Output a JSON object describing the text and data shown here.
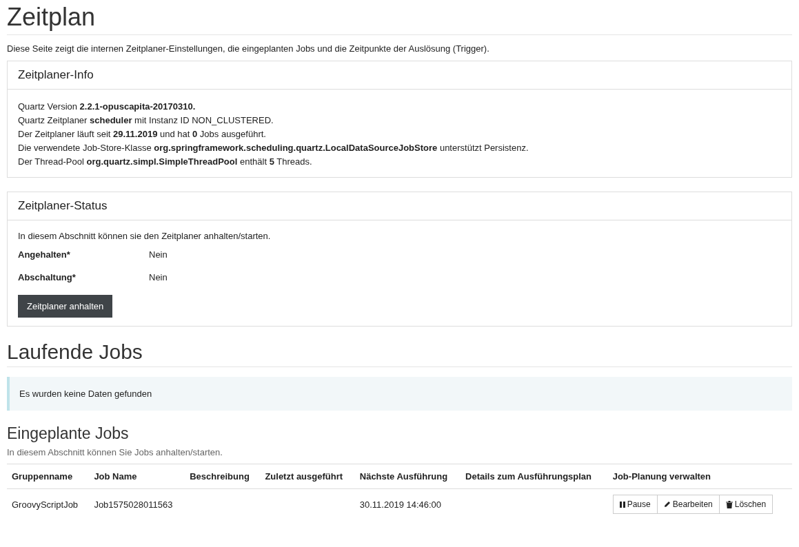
{
  "title": "Zeitplan",
  "intro": "Diese Seite zeigt die internen Zeitplaner-Einstellungen, die eingeplanten Jobs und die Zeitpunkte der Auslösung (Trigger).",
  "info_panel": {
    "heading": "Zeitplaner-Info",
    "lines": [
      "Quartz Version **2.2.1-opuscapita-20170310.**",
      "Quartz Zeitplaner **scheduler** mit Instanz ID NON_CLUSTERED.",
      "Der Zeitplaner läuft seit **29.11.2019** und hat **0** Jobs ausgeführt.",
      "Die verwendete Job-Store-Klasse **org.springframework.scheduling.quartz.LocalDataSourceJobStore** unterstützt Persistenz.",
      "Der Thread-Pool **org.quartz.simpl.SimpleThreadPool** enthält **5** Threads."
    ]
  },
  "status_panel": {
    "heading": "Zeitplaner-Status",
    "description": "In diesem Abschnitt können sie den Zeitplaner anhalten/starten.",
    "fields": [
      {
        "label": "Angehalten*",
        "value": "Nein"
      },
      {
        "label": "Abschaltung*",
        "value": "Nein"
      }
    ],
    "button": "Zeitplaner anhalten"
  },
  "running_jobs": {
    "heading": "Laufende Jobs",
    "empty_message": "Es wurden keine Daten gefunden"
  },
  "scheduled_jobs": {
    "heading": "Eingeplante Jobs",
    "description": "In diesem Abschnitt können Sie Jobs anhalten/starten.",
    "columns": [
      "Gruppenname",
      "Job Name",
      "Beschreibung",
      "Zuletzt ausgeführt",
      "Nächste Ausführung",
      "Details zum Ausführungsplan",
      "Job-Planung verwalten"
    ],
    "rows": [
      {
        "cells": [
          "GroovyScriptJob",
          "Job1575028011563",
          null,
          null,
          "30.11.2019 14:46:00",
          null
        ],
        "actions": [
          {
            "kind": "pause",
            "label": "Pause"
          },
          {
            "kind": "edit",
            "label": "Bearbeiten"
          },
          {
            "kind": "delete",
            "label": "Löschen"
          }
        ]
      }
    ]
  }
}
